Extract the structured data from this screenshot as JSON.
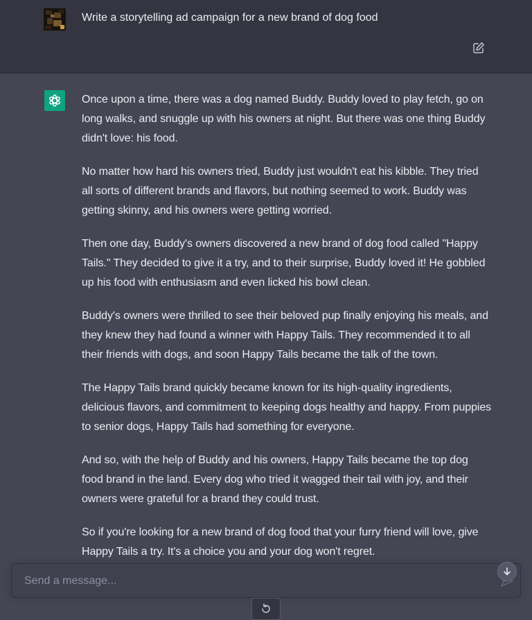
{
  "conversation": {
    "user_message": {
      "avatar": "user-avatar-image",
      "text": "Write a storytelling ad campaign for a new brand of dog food",
      "edit_icon": "edit-icon"
    },
    "assistant_message": {
      "avatar": "openai-logo-icon",
      "paragraphs": [
        "Once upon a time, there was a dog named Buddy. Buddy loved to play fetch, go on long walks, and snuggle up with his owners at night. But there was one thing Buddy didn't love: his food.",
        "No matter how hard his owners tried, Buddy just wouldn't eat his kibble. They tried all sorts of different brands and flavors, but nothing seemed to work. Buddy was getting skinny, and his owners were getting worried.",
        "Then one day, Buddy's owners discovered a new brand of dog food called \"Happy Tails.\" They decided to give it a try, and to their surprise, Buddy loved it! He gobbled up his food with enthusiasm and even licked his bowl clean.",
        "Buddy's owners were thrilled to see their beloved pup finally enjoying his meals, and they knew they had found a winner with Happy Tails. They recommended it to all their friends with dogs, and soon Happy Tails became the talk of the town.",
        "The Happy Tails brand quickly became known for its high-quality ingredients, delicious flavors, and commitment to keeping dogs healthy and happy. From puppies to senior dogs, Happy Tails had something for everyone.",
        "And so, with the help of Buddy and his owners, Happy Tails became the top dog food brand in the land. Every dog who tried it wagged their tail with joy, and their owners were grateful for a brand they could trust.",
        "So if you're looking for a new brand of dog food that your furry friend will love, give Happy Tails a try. It's a choice you and your dog won't regret."
      ]
    }
  },
  "composer": {
    "placeholder": "Send a message...",
    "value": "",
    "send_icon": "send-icon"
  },
  "controls": {
    "scroll_down_icon": "arrow-down-icon",
    "regenerate_icon": "regenerate-icon"
  },
  "colors": {
    "user_row_bg": "#343541",
    "assistant_row_bg": "#444654",
    "text": "#ececf1",
    "logo_bg": "#10a37f",
    "composer_bg": "#40414f"
  }
}
